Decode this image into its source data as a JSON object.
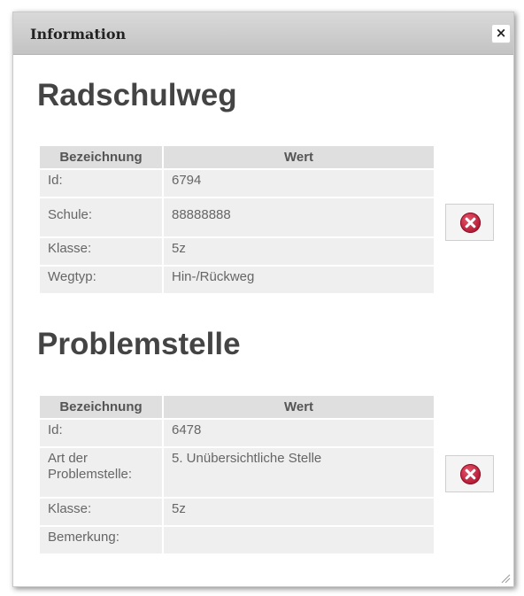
{
  "dialog": {
    "title": "Information",
    "close_label": "×"
  },
  "sections": [
    {
      "heading": "Radschulweg",
      "headers": [
        "Bezeichnung",
        "Wert"
      ],
      "rows": [
        {
          "label": "Id:",
          "value": "6794"
        },
        {
          "label": "Schule:",
          "value": "88888888"
        },
        {
          "label": "Klasse:",
          "value": "5z"
        },
        {
          "label": "Wegtyp:",
          "value": "Hin-/Rückweg"
        }
      ],
      "delete_icon": "delete-x-icon"
    },
    {
      "heading": "Problemstelle",
      "headers": [
        "Bezeichnung",
        "Wert"
      ],
      "rows": [
        {
          "label": "Id:",
          "value": "6478"
        },
        {
          "label": "Art der Problemstelle:",
          "value": "5. Unübersichtliche Stelle"
        },
        {
          "label": "Klasse:",
          "value": "5z"
        },
        {
          "label": "Bemerkung:",
          "value": ""
        }
      ],
      "delete_icon": "delete-x-icon"
    }
  ],
  "colors": {
    "header_bg": "#dfdfdf",
    "cell_bg": "#efefef",
    "heading_text": "#444444",
    "delete_icon": "#c0223c"
  }
}
